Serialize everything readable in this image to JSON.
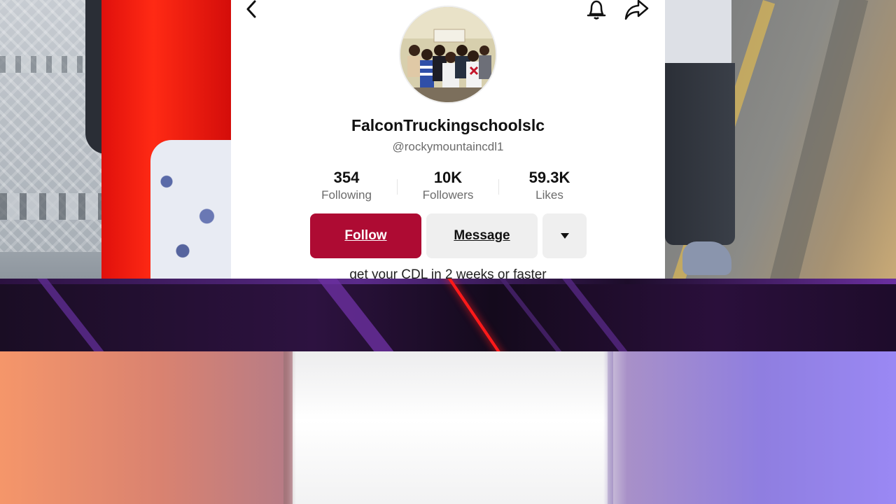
{
  "profile": {
    "username": "FalconTruckingschoolslc",
    "handle": "@rockymountaincdl1",
    "bio": "get your CDL in 2 weeks or faster",
    "avatar_icon": "group-photo-avatar"
  },
  "stats": [
    {
      "value": "354",
      "label": "Following"
    },
    {
      "value": "10K",
      "label": "Followers"
    },
    {
      "value": "59.3K",
      "label": "Likes"
    }
  ],
  "actions": {
    "follow_label": "Follow",
    "message_label": "Message",
    "more_label": "▾"
  },
  "nav": {
    "back_icon": "chevron-left-icon",
    "bell_icon": "bell-icon",
    "share_icon": "share-arrow-icon"
  },
  "colors": {
    "follow_button": "#ae0b33",
    "secondary_button": "#efefef",
    "band_purple": "#2d1240",
    "accent_red": "#ff1a1a"
  }
}
